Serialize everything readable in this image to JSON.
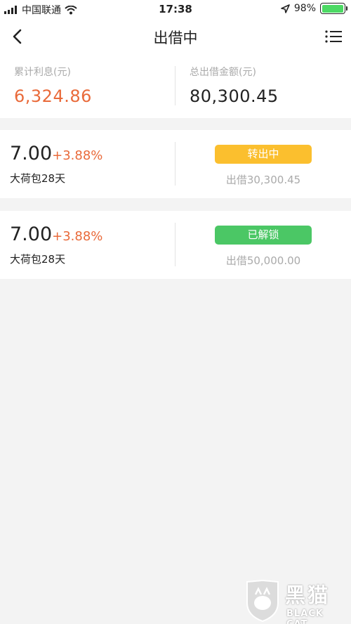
{
  "status_bar": {
    "carrier": "中国联通",
    "time": "17:38",
    "battery_text": "98%",
    "battery_level": 0.98,
    "battery_color": "#4cd964"
  },
  "nav": {
    "back_icon": "chevron-left-icon",
    "title": "出借中",
    "menu_icon": "list-icon"
  },
  "summary": {
    "interest_label": "累计利息(元)",
    "interest_value": "6,324.86",
    "interest_color": "#e96a3a",
    "total_label": "总出借金额(元)",
    "total_value": "80,300.45"
  },
  "loans": [
    {
      "rate_base": "7.00",
      "rate_bonus": "+3.88%",
      "product": "大荷包28天",
      "status": "转出中",
      "status_color": "#fbbf2e",
      "amount": "出借30,300.45"
    },
    {
      "rate_base": "7.00",
      "rate_bonus": "+3.88%",
      "product": "大荷包28天",
      "status": "已解锁",
      "status_color": "#4bc765",
      "amount": "出借50,000.00"
    }
  ],
  "watermark": {
    "text": "黑猫",
    "sub": "BLACK CAT"
  }
}
